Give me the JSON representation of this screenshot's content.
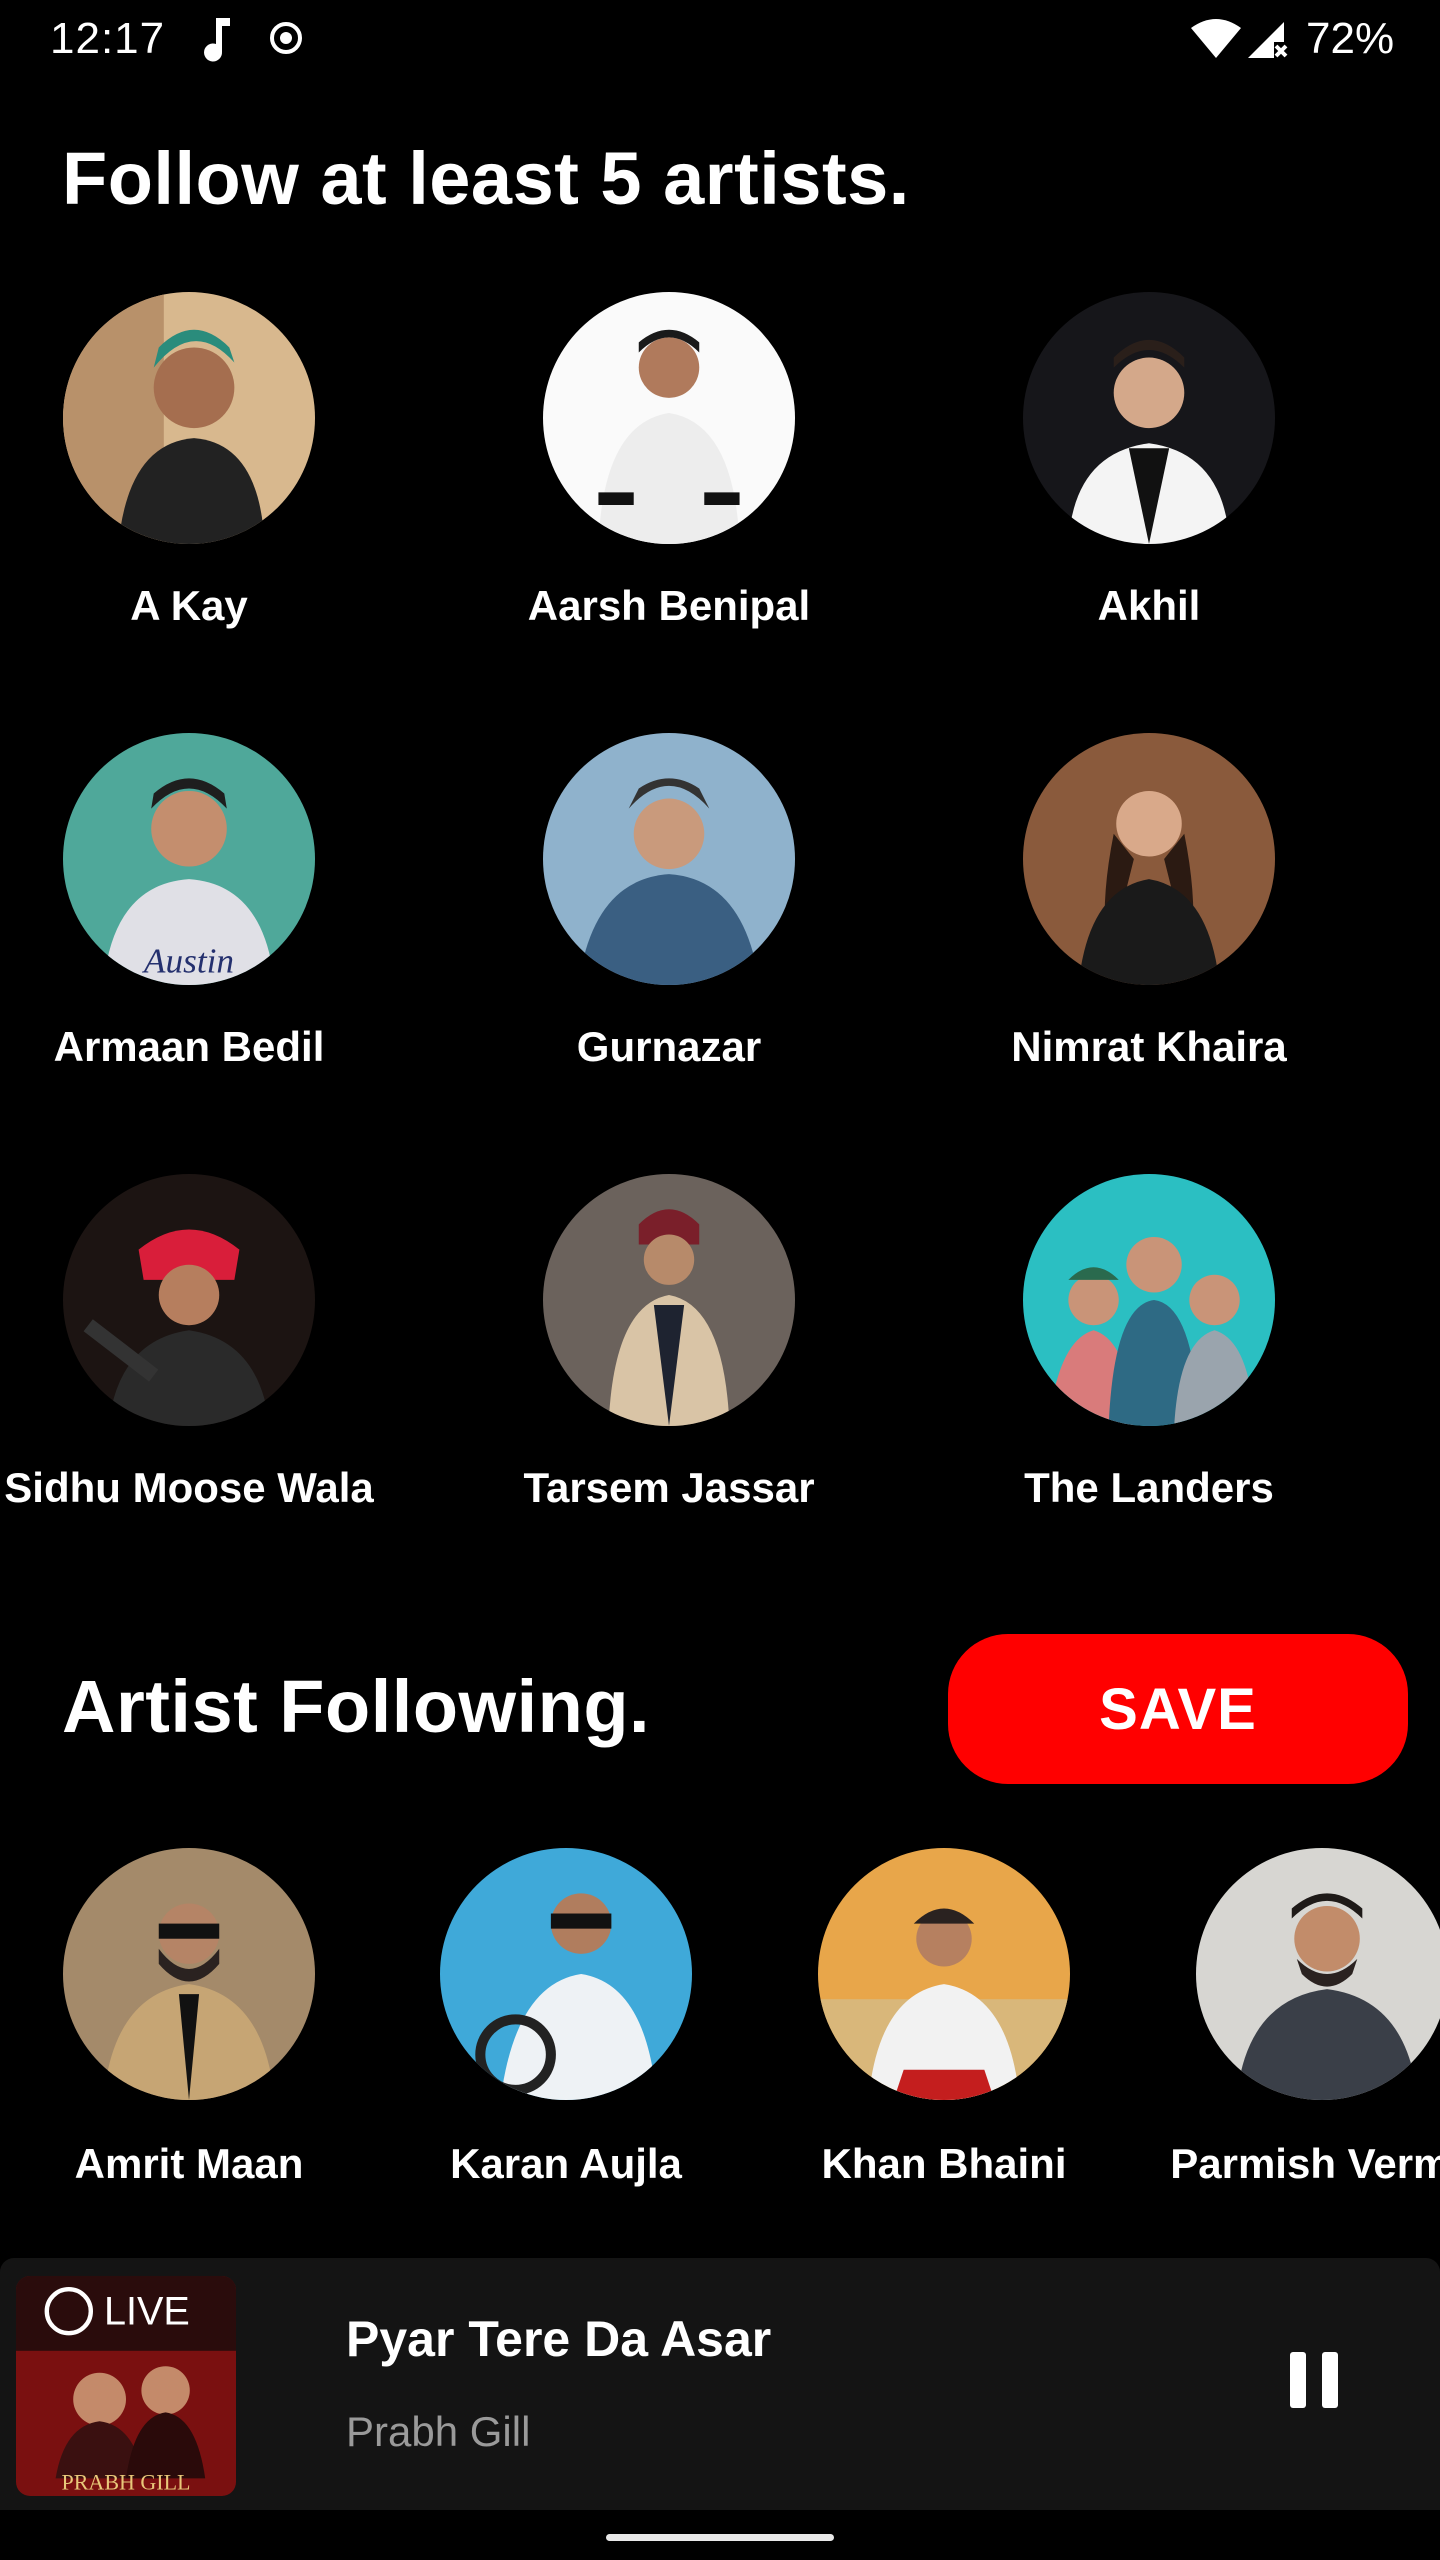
{
  "status_bar": {
    "time": "12:17",
    "battery": "72%",
    "icons": [
      "music-note-icon",
      "record-icon",
      "wifi-icon",
      "signal-icon"
    ]
  },
  "follow_section": {
    "title": "Follow at least 5 artists.",
    "artists": [
      {
        "name": "A Kay"
      },
      {
        "name": "Aarsh Benipal"
      },
      {
        "name": "Akhil"
      },
      {
        "name": "Armaan Bedil"
      },
      {
        "name": "Gurnazar"
      },
      {
        "name": "Nimrat Khaira"
      },
      {
        "name": "Sidhu Moose Wala"
      },
      {
        "name": "Tarsem Jassar"
      },
      {
        "name": "The Landers"
      }
    ]
  },
  "following_section": {
    "title": "Artist Following.",
    "save_label": "SAVE",
    "artists": [
      {
        "name": "Amrit Maan"
      },
      {
        "name": "Karan Aujla"
      },
      {
        "name": "Khan Bhaini"
      },
      {
        "name": "Parmish Verma"
      }
    ]
  },
  "mini_player": {
    "track_title": "Pyar Tere Da Asar",
    "track_artist": "Prabh Gill",
    "album_art_text": {
      "top": "LIVE",
      "bottom": "PRABH GILL"
    }
  },
  "colors": {
    "background": "#000000",
    "accent": "#ff0000",
    "player_bg": "#141414",
    "secondary_text": "#9a9a9a"
  }
}
